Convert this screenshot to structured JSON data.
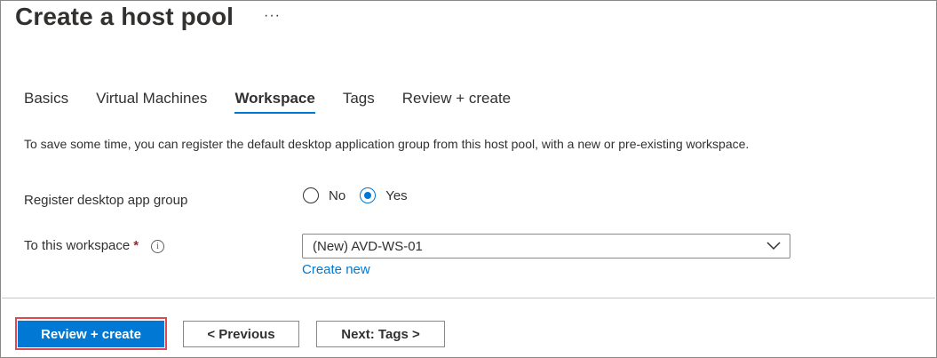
{
  "header": {
    "title": "Create a host pool",
    "more_icon": "more-horizontal-icon",
    "more_glyph": "···"
  },
  "tabs": [
    {
      "label": "Basics",
      "active": false
    },
    {
      "label": "Virtual Machines",
      "active": false
    },
    {
      "label": "Workspace",
      "active": true
    },
    {
      "label": "Tags",
      "active": false
    },
    {
      "label": "Review + create",
      "active": false
    }
  ],
  "intro": {
    "text": "To save some time, you can register the default desktop application group from this host pool, with a new or pre-existing workspace."
  },
  "register": {
    "label": "Register desktop app group",
    "options": [
      {
        "label": "No",
        "checked": false
      },
      {
        "label": "Yes",
        "checked": true
      }
    ]
  },
  "workspace": {
    "label": "To this workspace",
    "required_mark": "*",
    "info_icon": "info-icon",
    "info_glyph": "i",
    "selected_value": "(New) AVD-WS-01",
    "create_new_label": "Create new"
  },
  "footer": {
    "review_create_label": "Review + create",
    "previous_label": "< Previous",
    "next_label": "Next: Tags >"
  },
  "colors": {
    "accent": "#0078d4",
    "highlight": "#e0474f",
    "required": "#a4262c"
  }
}
